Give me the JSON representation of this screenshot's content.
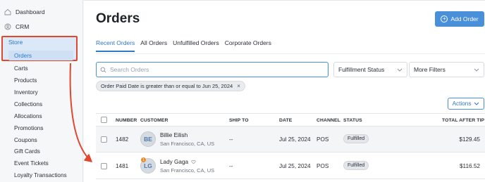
{
  "sidebar": {
    "top_items": [
      {
        "label": "Dashboard",
        "icon": "home-icon"
      },
      {
        "label": "CRM",
        "icon": "crm-icon"
      }
    ],
    "store": {
      "label": "Store",
      "icon": "store-icon"
    },
    "sub_items": [
      {
        "label": "Orders",
        "active": true
      },
      {
        "label": "Carts"
      },
      {
        "label": "Products"
      },
      {
        "label": "Inventory"
      },
      {
        "label": "Collections"
      },
      {
        "label": "Allocations"
      },
      {
        "label": "Promotions"
      },
      {
        "label": "Coupons"
      },
      {
        "label": "Gift Cards"
      },
      {
        "label": "Event Tickets"
      },
      {
        "label": "Loyalty Transactions"
      }
    ]
  },
  "header": {
    "title": "Orders",
    "add_button_label": "Add Order"
  },
  "tabs": [
    {
      "label": "Recent Orders",
      "active": true
    },
    {
      "label": "All Orders"
    },
    {
      "label": "Unfulfilled Orders"
    },
    {
      "label": "Corporate Orders"
    }
  ],
  "filters": {
    "search_placeholder": "Search Orders",
    "fulfillment_status_label": "Fulfillment Status",
    "more_filters_label": "More Filters",
    "active_chip": "Order Paid Date is greater than or equal to Jun 25, 2024",
    "chip_remove": "×"
  },
  "actions_label": "Actions",
  "table": {
    "columns": [
      "NUMBER",
      "CUSTOMER",
      "SHIP TO",
      "DATE",
      "CHANNEL",
      "STATUS",
      "TOTAL AFTER TIP"
    ],
    "rows": [
      {
        "number": "1482",
        "initials": "BE",
        "name": "Billie Eilish",
        "location": "San Francisco, CA, US",
        "ship_to": "--",
        "date": "Jul 25, 2024",
        "channel": "POS",
        "status": "Fulfilled",
        "total": "$129.45"
      },
      {
        "number": "1481",
        "initials": "LG",
        "badge": "1",
        "name": "Lady Gaga",
        "location": "San Francisco, CA, US",
        "ship_to": "--",
        "date": "Jul 25, 2024",
        "channel": "POS",
        "status": "Fulfilled",
        "total": "$116.52"
      }
    ]
  },
  "colors": {
    "accent": "#2e78c8",
    "annotation": "#e2462f"
  }
}
